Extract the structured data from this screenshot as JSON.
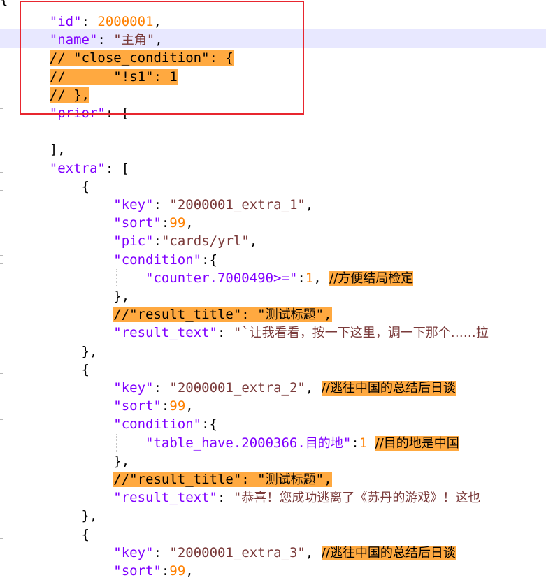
{
  "code_lines": [
    {
      "indent": "    ",
      "parts": [
        {
          "t": "\"id\"",
          "c": "key"
        },
        {
          "t": ": ",
          "c": "punc"
        },
        {
          "t": "2000001",
          "c": "num"
        },
        {
          "t": ",",
          "c": "punc"
        }
      ]
    },
    {
      "indent": "    ",
      "parts": [
        {
          "t": "\"name\"",
          "c": "key"
        },
        {
          "t": ": ",
          "c": "punc"
        },
        {
          "t": "\"",
          "c": "str"
        },
        {
          "t": "主角",
          "c": "str cjk"
        },
        {
          "t": "\"",
          "c": "str"
        },
        {
          "t": ",",
          "c": "punc"
        }
      ]
    },
    {
      "indent": "    ",
      "parts": [
        {
          "t": "// \"close_condition\": {",
          "c": "cm"
        }
      ]
    },
    {
      "indent": "    ",
      "parts": [
        {
          "t": "//      \"!s1\": 1",
          "c": "cm"
        }
      ]
    },
    {
      "indent": "    ",
      "parts": [
        {
          "t": "// },",
          "c": "cm"
        }
      ]
    },
    {
      "indent": "    ",
      "parts": [
        {
          "t": "\"prior\"",
          "c": "key"
        },
        {
          "t": ": [",
          "c": "punc"
        }
      ]
    },
    {
      "indent": "",
      "parts": []
    },
    {
      "indent": "    ",
      "parts": [
        {
          "t": "],",
          "c": "punc"
        }
      ]
    },
    {
      "indent": "    ",
      "parts": [
        {
          "t": "\"extra\"",
          "c": "key"
        },
        {
          "t": ": [",
          "c": "punc"
        }
      ]
    },
    {
      "indent": "        ",
      "parts": [
        {
          "t": "{",
          "c": "punc"
        }
      ]
    },
    {
      "indent": "            ",
      "parts": [
        {
          "t": "\"key\"",
          "c": "key"
        },
        {
          "t": ": ",
          "c": "punc"
        },
        {
          "t": "\"2000001_extra_1\"",
          "c": "str"
        },
        {
          "t": ",",
          "c": "punc"
        }
      ]
    },
    {
      "indent": "            ",
      "parts": [
        {
          "t": "\"sort\"",
          "c": "key"
        },
        {
          "t": ":",
          "c": "punc"
        },
        {
          "t": "99",
          "c": "num"
        },
        {
          "t": ",",
          "c": "punc"
        }
      ]
    },
    {
      "indent": "            ",
      "parts": [
        {
          "t": "\"pic\"",
          "c": "key"
        },
        {
          "t": ":",
          "c": "punc"
        },
        {
          "t": "\"cards/yrl\"",
          "c": "str"
        },
        {
          "t": ",",
          "c": "punc"
        }
      ]
    },
    {
      "indent": "            ",
      "parts": [
        {
          "t": "\"condition\"",
          "c": "key"
        },
        {
          "t": ":{",
          "c": "punc"
        }
      ]
    },
    {
      "indent": "                ",
      "parts": [
        {
          "t": "\"counter.7000490>=\"",
          "c": "key"
        },
        {
          "t": ":",
          "c": "punc"
        },
        {
          "t": "1",
          "c": "num"
        },
        {
          "t": ", ",
          "c": "punc"
        },
        {
          "t": "//方便结局检定",
          "c": "cm cjk"
        }
      ]
    },
    {
      "indent": "            ",
      "parts": [
        {
          "t": "},",
          "c": "punc"
        }
      ]
    },
    {
      "indent": "            ",
      "parts": [
        {
          "t": "//\"result_title\": \"",
          "c": "cm"
        },
        {
          "t": "测试标题",
          "c": "cm cjk"
        },
        {
          "t": "\",",
          "c": "cm"
        }
      ]
    },
    {
      "indent": "            ",
      "parts": [
        {
          "t": "\"result_text\"",
          "c": "key"
        },
        {
          "t": ": ",
          "c": "punc"
        },
        {
          "t": "\"`",
          "c": "str"
        },
        {
          "t": "让我看看，按一下这里，调一下那个……拉",
          "c": "str cjk"
        }
      ]
    },
    {
      "indent": "        ",
      "parts": [
        {
          "t": "},",
          "c": "punc"
        }
      ]
    },
    {
      "indent": "        ",
      "parts": [
        {
          "t": "{",
          "c": "punc"
        }
      ]
    },
    {
      "indent": "            ",
      "parts": [
        {
          "t": "\"key\"",
          "c": "key"
        },
        {
          "t": ": ",
          "c": "punc"
        },
        {
          "t": "\"2000001_extra_2\"",
          "c": "str"
        },
        {
          "t": ", ",
          "c": "punc"
        },
        {
          "t": "//逃往中国的总结后日谈",
          "c": "cm cjk"
        }
      ]
    },
    {
      "indent": "            ",
      "parts": [
        {
          "t": "\"sort\"",
          "c": "key"
        },
        {
          "t": ":",
          "c": "punc"
        },
        {
          "t": "99",
          "c": "num"
        },
        {
          "t": ",",
          "c": "punc"
        }
      ]
    },
    {
      "indent": "            ",
      "parts": [
        {
          "t": "\"condition\"",
          "c": "key"
        },
        {
          "t": ":{",
          "c": "punc"
        }
      ]
    },
    {
      "indent": "                ",
      "parts": [
        {
          "t": "\"table_have.2000366.",
          "c": "key"
        },
        {
          "t": "目的地",
          "c": "key cjk"
        },
        {
          "t": "\"",
          "c": "key"
        },
        {
          "t": ":",
          "c": "punc"
        },
        {
          "t": "1",
          "c": "num"
        },
        {
          "t": " ",
          "c": "punc"
        },
        {
          "t": "//目的地是中国",
          "c": "cm cjk"
        }
      ]
    },
    {
      "indent": "            ",
      "parts": [
        {
          "t": "},",
          "c": "punc"
        }
      ]
    },
    {
      "indent": "            ",
      "parts": [
        {
          "t": "//\"result_title\": \"",
          "c": "cm"
        },
        {
          "t": "测试标题",
          "c": "cm cjk"
        },
        {
          "t": "\",",
          "c": "cm"
        }
      ]
    },
    {
      "indent": "            ",
      "parts": [
        {
          "t": "\"result_text\"",
          "c": "key"
        },
        {
          "t": ": ",
          "c": "punc"
        },
        {
          "t": "\"",
          "c": "str"
        },
        {
          "t": "恭喜！您成功逃离了《苏丹的游戏》！这也",
          "c": "str cjk"
        }
      ]
    },
    {
      "indent": "        ",
      "parts": [
        {
          "t": "},",
          "c": "punc"
        }
      ]
    },
    {
      "indent": "        ",
      "parts": [
        {
          "t": "{",
          "c": "punc"
        }
      ]
    },
    {
      "indent": "            ",
      "parts": [
        {
          "t": "\"key\"",
          "c": "key"
        },
        {
          "t": ": ",
          "c": "punc"
        },
        {
          "t": "\"2000001_extra_3\"",
          "c": "str"
        },
        {
          "t": ", ",
          "c": "punc"
        },
        {
          "t": "//逃往中国的总结后日谈",
          "c": "cm cjk"
        }
      ]
    },
    {
      "indent": "            ",
      "parts": [
        {
          "t": "\"sort\"",
          "c": "key"
        },
        {
          "t": ":",
          "c": "punc"
        },
        {
          "t": "99",
          "c": "num"
        },
        {
          "t": ",",
          "c": "punc"
        }
      ]
    }
  ],
  "first_line_fragment": "{",
  "highlighted_line": 2
}
